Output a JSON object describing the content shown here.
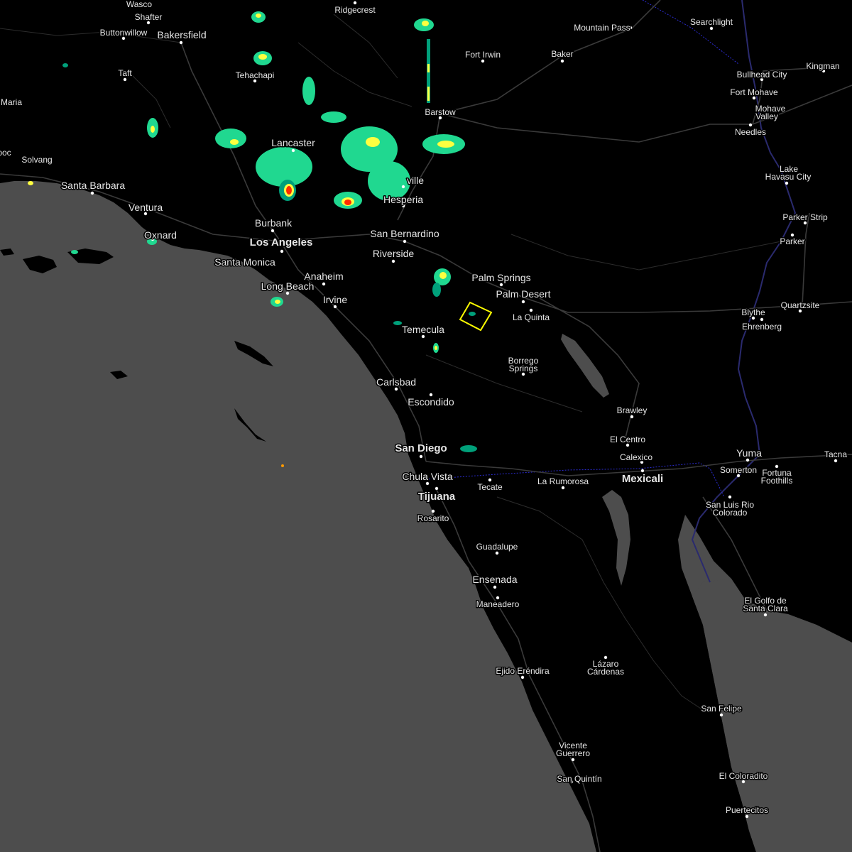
{
  "map": {
    "colors": {
      "ocean": "#4d4d4d",
      "land": "#000000",
      "lake": "#4d4d4d",
      "warning_outline": "#ffff00",
      "radar_light": "#00a07a",
      "radar_mid": "#20d890",
      "radar_yellow": "#ffff40",
      "radar_orange": "#ff9a00",
      "radar_red": "#ff2a00",
      "border": "#2b2bd0"
    },
    "places": [
      {
        "id": "wasco",
        "label": "Wasco"
      },
      {
        "id": "shafter",
        "label": "Shafter"
      },
      {
        "id": "buttonwillow",
        "label": "Buttonwillow"
      },
      {
        "id": "bakersfield",
        "label": "Bakersfield"
      },
      {
        "id": "ridgecrest",
        "label": "Ridgecrest"
      },
      {
        "id": "mountain_pass",
        "label": "Mountain Pass"
      },
      {
        "id": "searchlight",
        "label": "Searchlight"
      },
      {
        "id": "fort_irwin",
        "label": "Fort Irwin"
      },
      {
        "id": "baker",
        "label": "Baker"
      },
      {
        "id": "kingman",
        "label": "Kingman"
      },
      {
        "id": "bullhead_city",
        "label": "Bullhead City"
      },
      {
        "id": "fort_mohave",
        "label": "Fort Mohave"
      },
      {
        "id": "mohave_valley_1",
        "label": "Mohave"
      },
      {
        "id": "mohave_valley_2",
        "label": "Valley"
      },
      {
        "id": "taft",
        "label": "Taft"
      },
      {
        "id": "tehachapi",
        "label": "Tehachapi"
      },
      {
        "id": "maria",
        "label": "Maria"
      },
      {
        "id": "barstow",
        "label": "Barstow"
      },
      {
        "id": "needles",
        "label": "Needles"
      },
      {
        "id": "lancaster",
        "label": "Lancaster"
      },
      {
        "id": "lake_havasu_1",
        "label": "Lake"
      },
      {
        "id": "lake_havasu_2",
        "label": "Havasu City"
      },
      {
        "id": "solvang",
        "label": "Solvang"
      },
      {
        "id": "poc",
        "label": "poc"
      },
      {
        "id": "victorville",
        "label": "ville"
      },
      {
        "id": "santa_barbara",
        "label": "Santa Barbara"
      },
      {
        "id": "hesperia",
        "label": "Hesperia"
      },
      {
        "id": "ventura",
        "label": "Ventura"
      },
      {
        "id": "parker_strip",
        "label": "Parker Strip"
      },
      {
        "id": "burbank",
        "label": "Burbank"
      },
      {
        "id": "oxnard",
        "label": "Oxnard"
      },
      {
        "id": "san_bernardino",
        "label": "San Bernardino"
      },
      {
        "id": "parker",
        "label": "Parker"
      },
      {
        "id": "los_angeles",
        "label": "Los Angeles"
      },
      {
        "id": "riverside",
        "label": "Riverside"
      },
      {
        "id": "santa_monica",
        "label": "Santa Monica"
      },
      {
        "id": "anaheim",
        "label": "Anaheim"
      },
      {
        "id": "palm_springs",
        "label": "Palm Springs"
      },
      {
        "id": "long_beach",
        "label": "Long Beach"
      },
      {
        "id": "palm_desert",
        "label": "Palm Desert"
      },
      {
        "id": "irvine",
        "label": "Irvine"
      },
      {
        "id": "blythe",
        "label": "Blythe"
      },
      {
        "id": "quartzsite",
        "label": "Quartzsite"
      },
      {
        "id": "la_quinta",
        "label": "La Quinta"
      },
      {
        "id": "ehrenberg",
        "label": "Ehrenberg"
      },
      {
        "id": "temecula",
        "label": "Temecula"
      },
      {
        "id": "borrego_1",
        "label": "Borrego"
      },
      {
        "id": "borrego_2",
        "label": "Springs"
      },
      {
        "id": "carlsbad",
        "label": "Carlsbad"
      },
      {
        "id": "escondido",
        "label": "Escondido"
      },
      {
        "id": "brawley",
        "label": "Brawley"
      },
      {
        "id": "el_centro",
        "label": "El Centro"
      },
      {
        "id": "san_diego",
        "label": "San Diego"
      },
      {
        "id": "yuma",
        "label": "Yuma"
      },
      {
        "id": "calexico",
        "label": "Calexico"
      },
      {
        "id": "tacna",
        "label": "Tacna"
      },
      {
        "id": "somerton",
        "label": "Somerton"
      },
      {
        "id": "fortuna_1",
        "label": "Fortuna"
      },
      {
        "id": "fortuna_2",
        "label": "Foothills"
      },
      {
        "id": "chula_vista",
        "label": "Chula Vista"
      },
      {
        "id": "mexicali",
        "label": "Mexicali"
      },
      {
        "id": "la_rumorosa",
        "label": "La Rumorosa"
      },
      {
        "id": "tecate",
        "label": "Tecate"
      },
      {
        "id": "tijuana",
        "label": "Tijuana"
      },
      {
        "id": "san_luis_1",
        "label": "San Luis Rio"
      },
      {
        "id": "san_luis_2",
        "label": "Colorado"
      },
      {
        "id": "rosarito",
        "label": "Rosarito"
      },
      {
        "id": "guadalupe",
        "label": "Guadalupe"
      },
      {
        "id": "ensenada",
        "label": "Ensenada"
      },
      {
        "id": "el_golfo_1",
        "label": "El Golfo de"
      },
      {
        "id": "el_golfo_2",
        "label": "Santa Clara"
      },
      {
        "id": "maneadero",
        "label": "Maneadero"
      },
      {
        "id": "ejido",
        "label": "Ejido Eréndira"
      },
      {
        "id": "lazaro_1",
        "label": "Lázaro"
      },
      {
        "id": "lazaro_2",
        "label": "Cárdenas"
      },
      {
        "id": "san_felipe",
        "label": "San Felipe"
      },
      {
        "id": "vicente_1",
        "label": "Vicente"
      },
      {
        "id": "vicente_2",
        "label": "Guerrero"
      },
      {
        "id": "san_quintin",
        "label": "San Quintín"
      },
      {
        "id": "el_coloradito",
        "label": "El Coloradito"
      },
      {
        "id": "puertecitos",
        "label": "Puertecitos"
      }
    ]
  }
}
